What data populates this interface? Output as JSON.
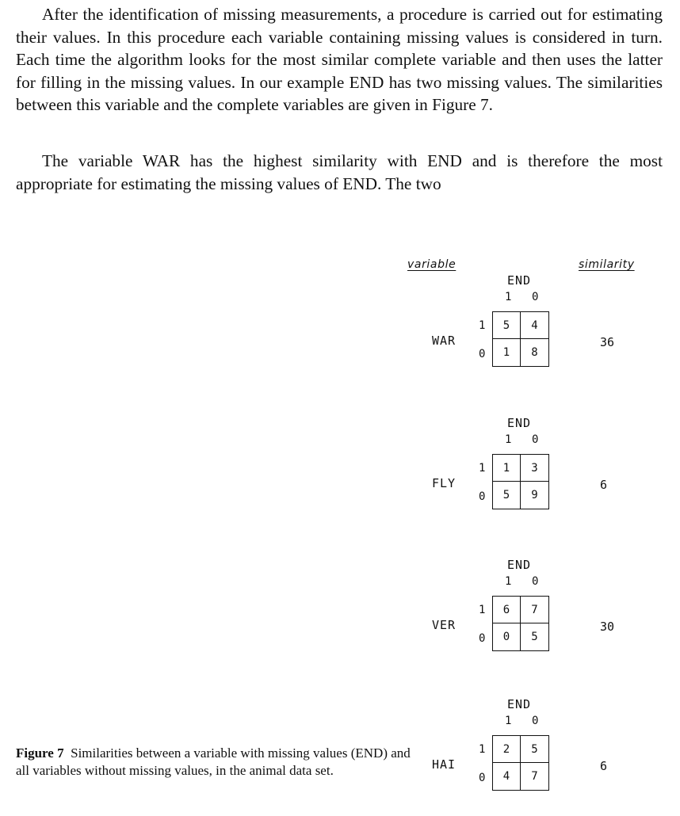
{
  "paragraphs": [
    "After the identification of missing measurements, a procedure is carried out for estimating their values. In this procedure each variable containing missing values is considered in turn. Each time the algorithm looks for the most similar complete variable and then uses the latter for filling in the missing values. In our example END has two missing values. The similarities between this variable and the complete variables are given in Figure 7.",
    "The variable WAR has the highest similarity with END and is therefore the most appropriate for estimating the missing values of END. The two"
  ],
  "figure": {
    "column_headers": {
      "variable": "variable",
      "similarity": "similarity"
    },
    "tables": [
      {
        "variable": "WAR",
        "target": "END",
        "col_levels": [
          "1",
          "0"
        ],
        "row_levels": [
          "1",
          "0"
        ],
        "cells": [
          "5",
          "4",
          "1",
          "8"
        ],
        "similarity": "36"
      },
      {
        "variable": "FLY",
        "target": "END",
        "col_levels": [
          "1",
          "0"
        ],
        "row_levels": [
          "1",
          "0"
        ],
        "cells": [
          "1",
          "3",
          "5",
          "9"
        ],
        "similarity": "6"
      },
      {
        "variable": "VER",
        "target": "END",
        "col_levels": [
          "1",
          "0"
        ],
        "row_levels": [
          "1",
          "0"
        ],
        "cells": [
          "6",
          "7",
          "0",
          "5"
        ],
        "similarity": "30"
      },
      {
        "variable": "HAI",
        "target": "END",
        "col_levels": [
          "1",
          "0"
        ],
        "row_levels": [
          "1",
          "0"
        ],
        "cells": [
          "2",
          "5",
          "4",
          "7"
        ],
        "similarity": "6"
      }
    ],
    "caption": {
      "label": "Figure 7",
      "text": "Similarities between a variable with missing values (END) and all variables without missing values, in the animal data set."
    }
  }
}
